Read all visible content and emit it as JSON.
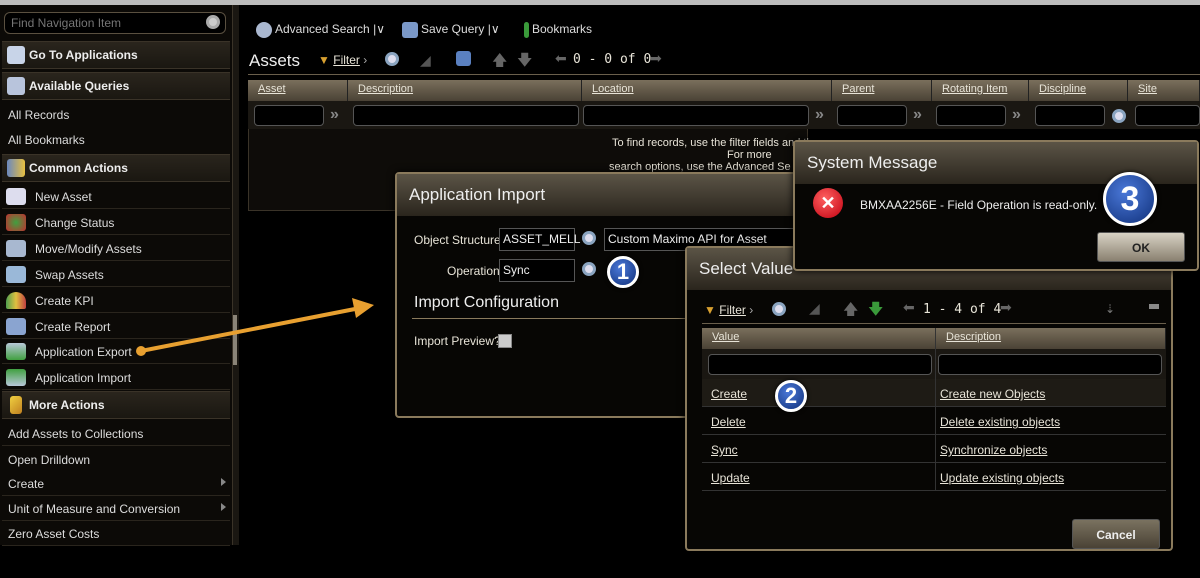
{
  "sidebar": {
    "search_placeholder": "Find Navigation Item",
    "go_to_apps": "Go To Applications",
    "available_queries": "Available Queries",
    "queries": [
      "All Records",
      "All Bookmarks"
    ],
    "common_actions": "Common Actions",
    "actions": [
      "New Asset",
      "Change Status",
      "Move/Modify Assets",
      "Swap Assets",
      "Create KPI",
      "Create Report",
      "Application Export",
      "Application Import"
    ],
    "more_actions": "More Actions",
    "more": [
      "Add Assets to Collections",
      "Open Drilldown",
      "Create",
      "Unit of Measure and Conversion",
      "Zero Asset Costs"
    ]
  },
  "toolbar": {
    "advanced_search": "Advanced Search",
    "save_query": "Save Query",
    "bookmarks": "Bookmarks"
  },
  "list": {
    "title": "Assets",
    "filter": "Filter",
    "paging": "0 - 0 of 0",
    "columns": [
      "Asset",
      "Description",
      "Location",
      "Parent",
      "Rotating Item",
      "Discipline",
      "Site"
    ],
    "message_1": "To find records, use the filter fields and the",
    "message_2": "For more",
    "message_3": "search options, use the Advanced Se"
  },
  "import_dialog": {
    "title": "Application Import",
    "object_structure_label": "Object Structure:",
    "object_structure": "ASSET_MELL",
    "object_desc": "Custom Maximo API for Asset",
    "operation_label": "Operation:",
    "operation": "Sync",
    "section": "Import Configuration",
    "preview_label": "Import Preview?"
  },
  "select_value": {
    "title": "Select Value",
    "filter": "Filter",
    "paging": "1 - 4 of 4",
    "columns": [
      "Value",
      "Description"
    ],
    "rows": [
      {
        "value": "Create",
        "desc": "Create new Objects"
      },
      {
        "value": "Delete",
        "desc": "Delete existing objects"
      },
      {
        "value": "Sync",
        "desc": "Synchronize objects"
      },
      {
        "value": "Update",
        "desc": "Update existing objects"
      }
    ],
    "cancel": "Cancel"
  },
  "system_message": {
    "title": "System Message",
    "text": "BMXAA2256E - Field Operation is read-only.",
    "ok": "OK"
  },
  "badges": [
    "1",
    "2",
    "3"
  ],
  "colors": {
    "arrow": "#e8a030",
    "accent_border": "#8a7a5c"
  }
}
